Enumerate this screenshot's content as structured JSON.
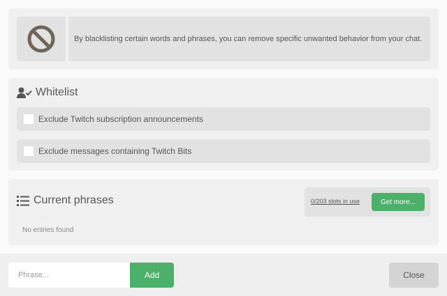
{
  "info": {
    "icon": "ban-icon",
    "text": "By blacklisting certain words and phrases, you can remove specific unwanted behavior from your chat."
  },
  "whitelist": {
    "icon": "user-check-icon",
    "title": "Whitelist",
    "options": [
      {
        "label": "Exclude Twitch subscription announcements",
        "checked": false
      },
      {
        "label": "Exclude messages containing Twitch Bits",
        "checked": false
      }
    ]
  },
  "phrases": {
    "icon": "list-icon",
    "title": "Current phrases",
    "slots_text": "0/203 slots in use",
    "get_more_label": "Get more...",
    "empty_text": "No entries found"
  },
  "footer": {
    "input_placeholder": "Phrase...",
    "input_value": "",
    "add_label": "Add",
    "close_label": "Close"
  },
  "colors": {
    "accent_green": "#4caf6a",
    "panel_bg": "#f0f0f0",
    "row_bg": "#e2e2e2",
    "icon_color": "#6e6458"
  }
}
